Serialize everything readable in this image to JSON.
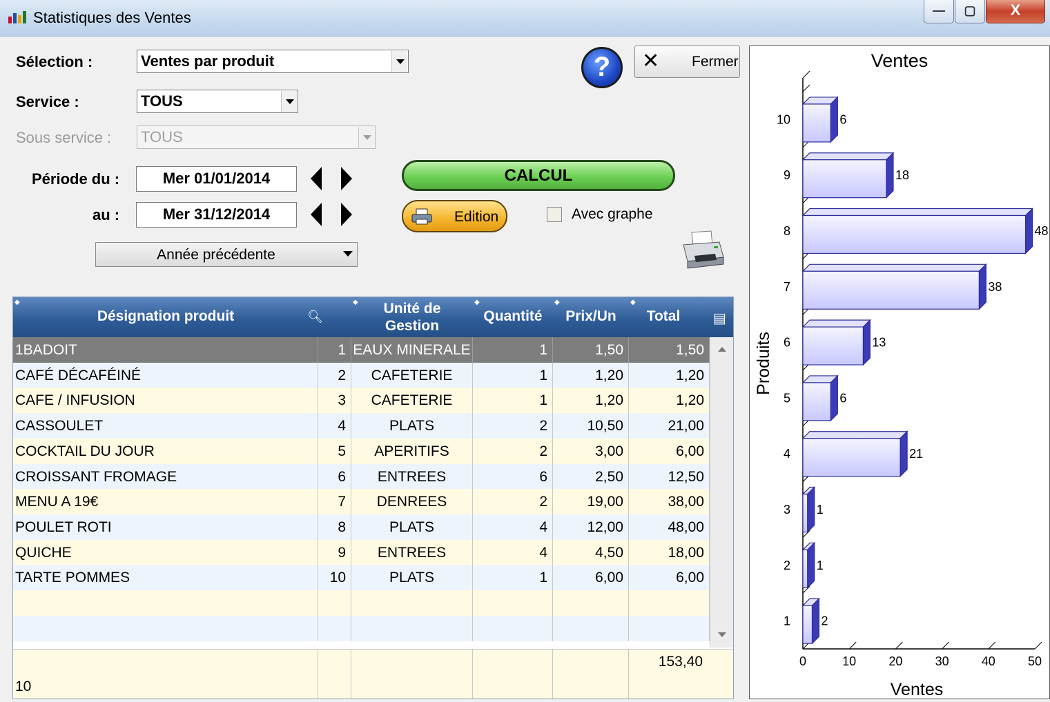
{
  "window": {
    "title": "Statistiques des Ventes",
    "minimize": "—",
    "maximize": "▢",
    "close": "X"
  },
  "form": {
    "selection_label": "Sélection :",
    "selection_value": "Ventes par produit",
    "service_label": "Service :",
    "service_value": "TOUS",
    "sous_service_label": "Sous service :",
    "sous_service_value": "TOUS",
    "periode_label": "Période du :",
    "date_from": "Mer 01/01/2014",
    "au_label": "au :",
    "date_to": "Mer 31/12/2014",
    "period_preset": "Année précédente"
  },
  "buttons": {
    "help": "?",
    "close_label": "Fermer",
    "calcul": "CALCUL",
    "edition": "Edition",
    "avec_graphe": "Avec graphe"
  },
  "grid": {
    "headers": {
      "designation": "Désignation produit",
      "unite_line1": "Unité de",
      "unite_line2": "Gestion",
      "quantite": "Quantité",
      "prix": "Prix/Un",
      "total": "Total"
    },
    "rows": [
      {
        "name": "1BADOIT",
        "num": "1",
        "unite": "EAUX MINERALE",
        "qty": "1",
        "prix": "1,50",
        "total": "1,50"
      },
      {
        "name": "CAFÉ DÉCAFÉINÉ",
        "num": "2",
        "unite": "CAFETERIE",
        "qty": "1",
        "prix": "1,20",
        "total": "1,20"
      },
      {
        "name": "CAFE / INFUSION",
        "num": "3",
        "unite": "CAFETERIE",
        "qty": "1",
        "prix": "1,20",
        "total": "1,20"
      },
      {
        "name": "CASSOULET",
        "num": "4",
        "unite": "PLATS",
        "qty": "2",
        "prix": "10,50",
        "total": "21,00"
      },
      {
        "name": "COCKTAIL DU JOUR",
        "num": "5",
        "unite": "APERITIFS",
        "qty": "2",
        "prix": "3,00",
        "total": "6,00"
      },
      {
        "name": "CROISSANT FROMAGE",
        "num": "6",
        "unite": "ENTREES",
        "qty": "6",
        "prix": "2,50",
        "total": "12,50"
      },
      {
        "name": "MENU A 19€",
        "num": "7",
        "unite": "DENREES",
        "qty": "2",
        "prix": "19,00",
        "total": "38,00"
      },
      {
        "name": "POULET ROTI",
        "num": "8",
        "unite": "PLATS",
        "qty": "4",
        "prix": "12,00",
        "total": "48,00"
      },
      {
        "name": "QUICHE",
        "num": "9",
        "unite": "ENTREES",
        "qty": "4",
        "prix": "4,50",
        "total": "18,00"
      },
      {
        "name": "TARTE POMMES",
        "num": "10",
        "unite": "PLATS",
        "qty": "1",
        "prix": "6,00",
        "total": "6,00"
      }
    ],
    "footer_total": "153,40",
    "footer_count": "10"
  },
  "chart_data": {
    "type": "bar",
    "orientation": "horizontal",
    "style": "3d",
    "title": "Ventes",
    "xlabel": "Ventes",
    "ylabel": "Produits",
    "categories": [
      "1",
      "2",
      "3",
      "4",
      "5",
      "6",
      "7",
      "8",
      "9",
      "10"
    ],
    "values": [
      2,
      1,
      1,
      21,
      6,
      13,
      38,
      48,
      18,
      6
    ],
    "xlim": [
      0,
      50
    ],
    "xticks": [
      0,
      10,
      20,
      30,
      40,
      50
    ],
    "bar_color": "#c8c8ff",
    "bar_edge": "#2b2b9a",
    "grid": false
  }
}
